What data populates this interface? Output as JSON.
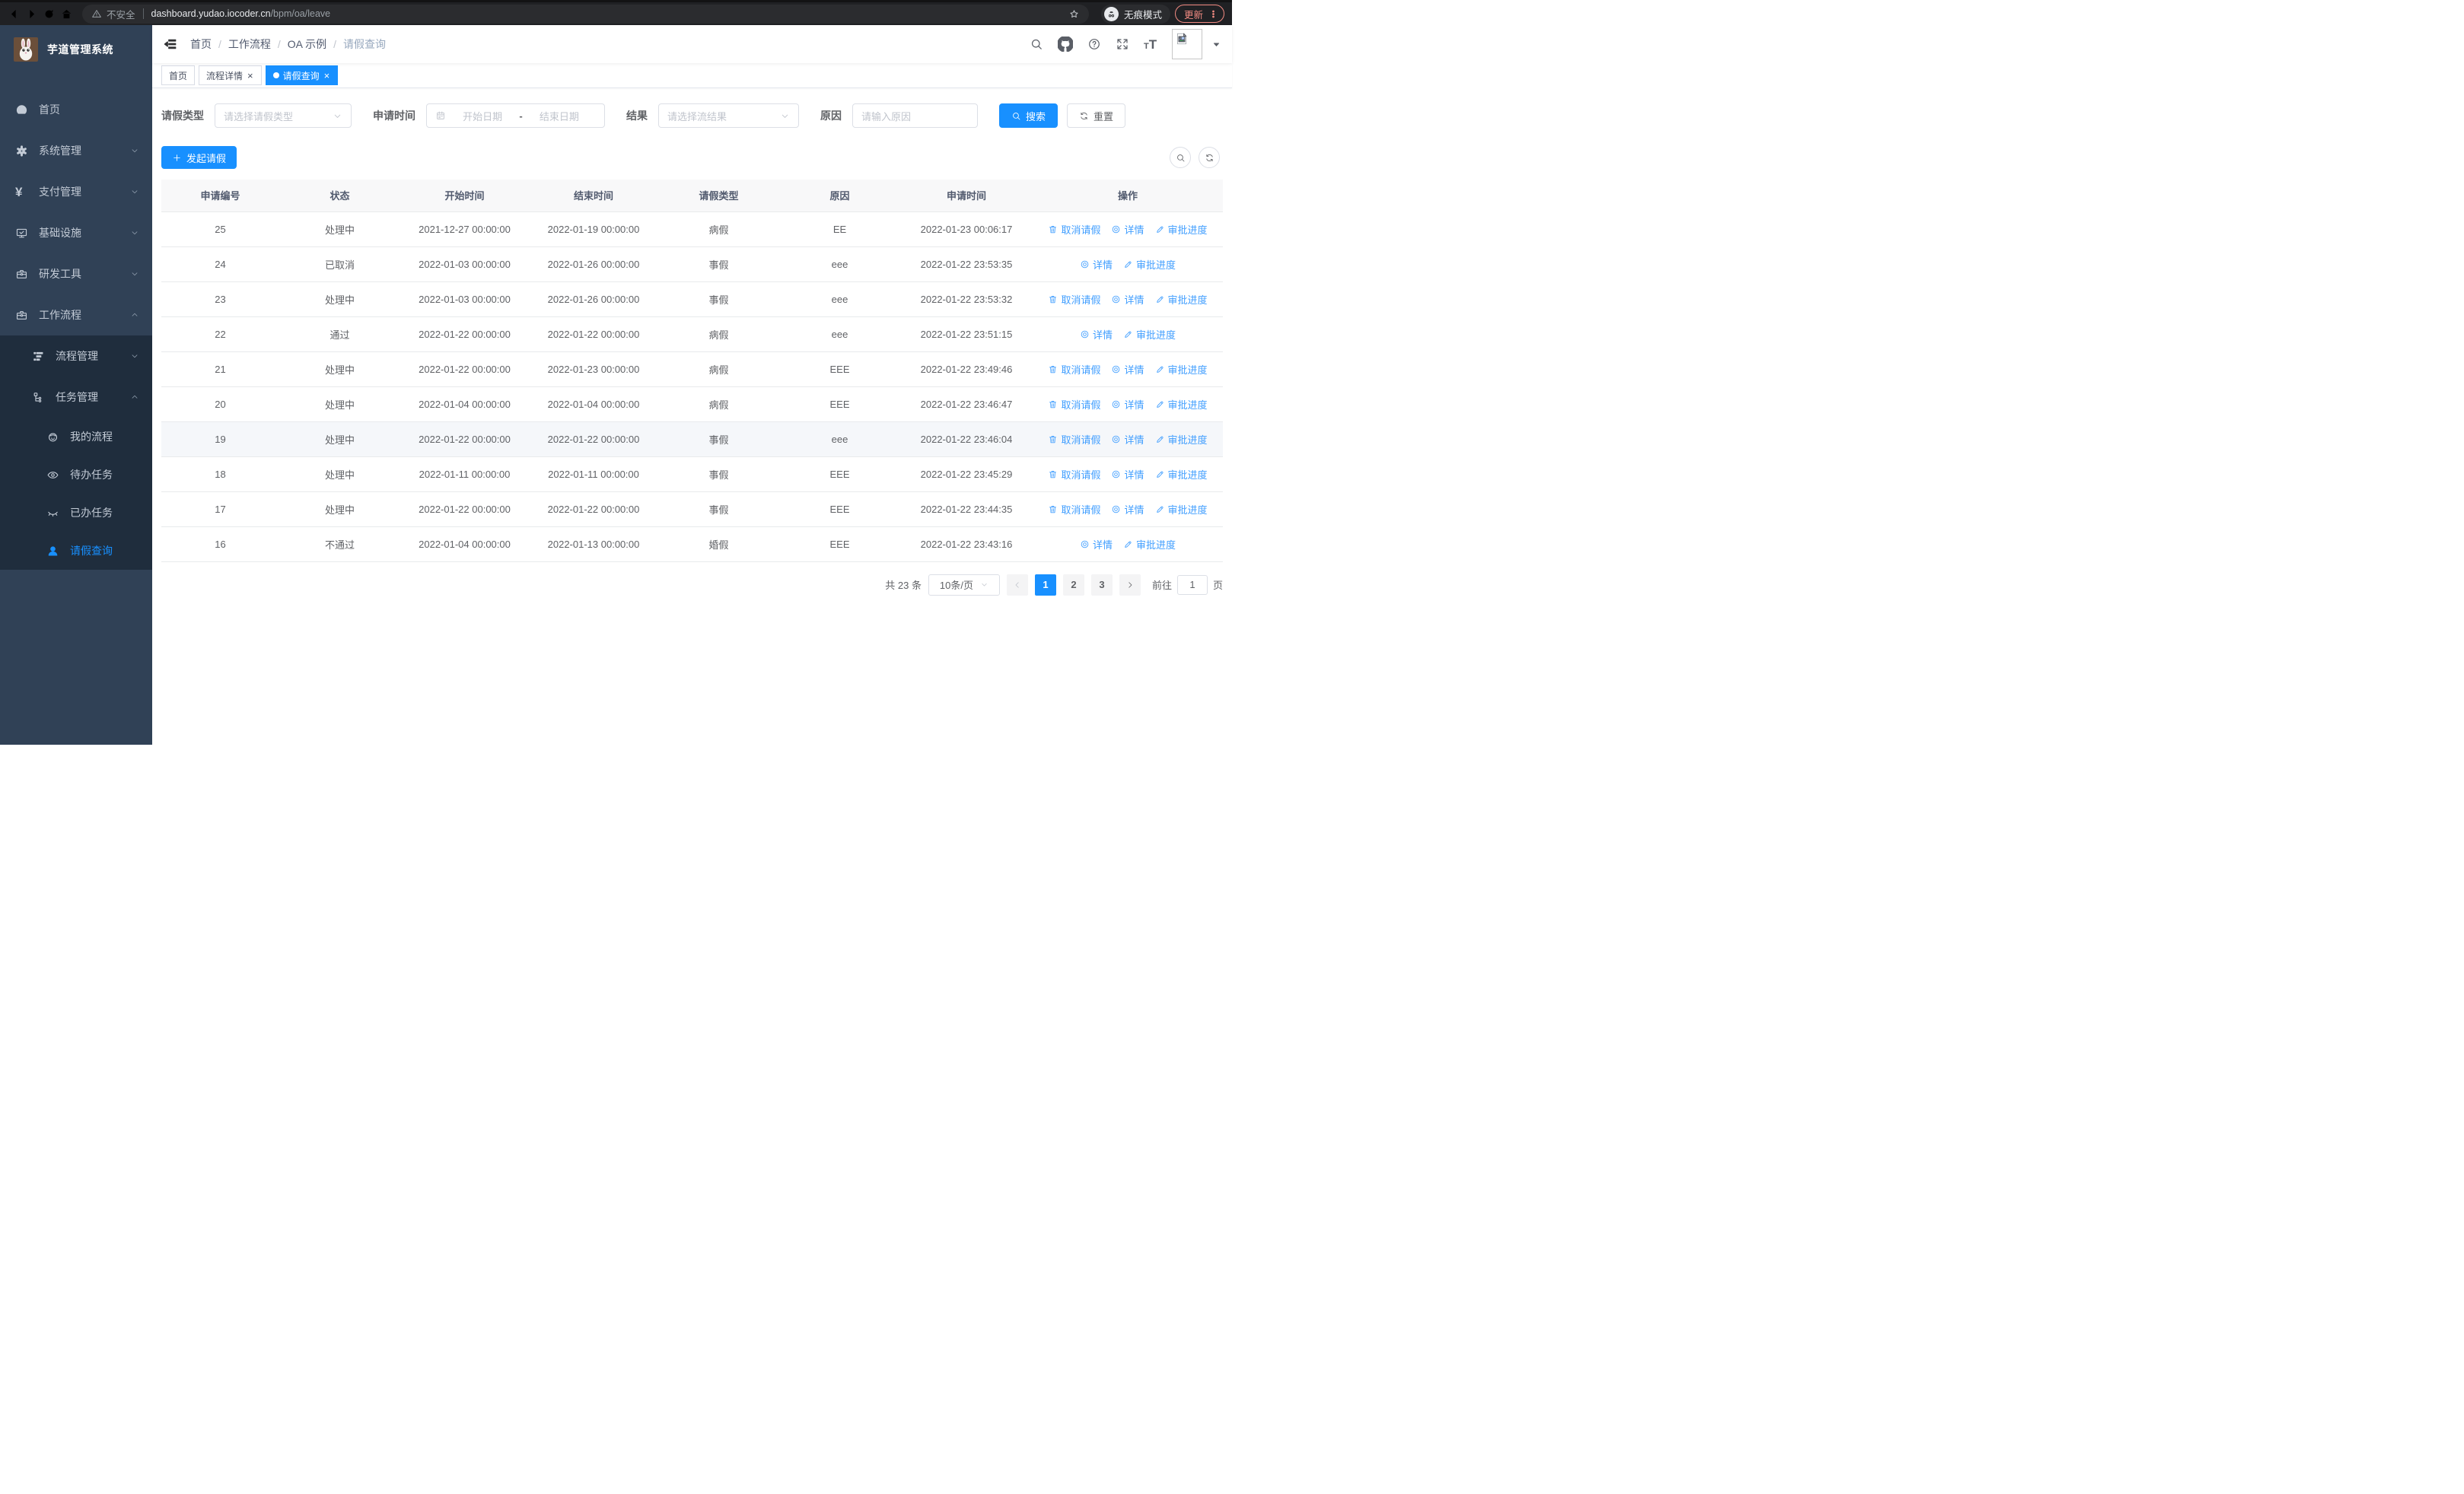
{
  "colors": {
    "primary": "#1890ff",
    "link": "#409eff",
    "sidebar_bg": "#304156",
    "submenu_bg": "#1f2d3d",
    "update_accent": "#f28b82"
  },
  "browser": {
    "security_label": "不安全",
    "url_host": "dashboard.yudao.iocoder.cn",
    "url_path": "/bpm/oa/leave",
    "incognito_label": "无痕模式",
    "update_label": "更新"
  },
  "sidebar": {
    "title": "芋道管理系统",
    "items": [
      {
        "name": "home",
        "icon": "dashboard-icon",
        "label": "首页",
        "level": 1
      },
      {
        "name": "system-management",
        "icon": "gear-icon",
        "label": "系统管理",
        "level": 1,
        "chevron": "down"
      },
      {
        "name": "payment-management",
        "icon": "yen-icon",
        "label": "支付管理",
        "level": 1,
        "chevron": "down"
      },
      {
        "name": "infrastructure",
        "icon": "monitor-icon",
        "label": "基础设施",
        "level": 1,
        "chevron": "down"
      },
      {
        "name": "dev-tools",
        "icon": "toolbox-icon",
        "label": "研发工具",
        "level": 1,
        "chevron": "down"
      },
      {
        "name": "workflow",
        "icon": "toolbox-icon",
        "label": "工作流程",
        "level": 1,
        "chevron": "up"
      },
      {
        "name": "process-management",
        "icon": "list-tree-icon",
        "label": "流程管理",
        "level": 2,
        "chevron": "down",
        "sub": true
      },
      {
        "name": "task-management",
        "icon": "org-tree-icon",
        "label": "任务管理",
        "level": 2,
        "chevron": "up",
        "sub": true
      },
      {
        "name": "my-processes",
        "icon": "robot-icon",
        "label": "我的流程",
        "level": 3,
        "sub": true
      },
      {
        "name": "todo-tasks",
        "icon": "eye-open-icon",
        "label": "待办任务",
        "level": 3,
        "sub": true
      },
      {
        "name": "done-tasks",
        "icon": "eye-closed-icon",
        "label": "已办任务",
        "level": 3,
        "sub": true
      },
      {
        "name": "leave-query",
        "icon": "user-icon",
        "label": "请假查询",
        "level": 3,
        "sub": true,
        "active": true
      }
    ]
  },
  "header": {
    "breadcrumb": [
      "首页",
      "工作流程",
      "OA 示例",
      "请假查询"
    ],
    "icons": [
      {
        "name": "search-icon"
      },
      {
        "name": "github-icon"
      },
      {
        "name": "help-icon"
      },
      {
        "name": "fullscreen-icon"
      },
      {
        "name": "font-size-icon"
      }
    ]
  },
  "tabs": [
    {
      "name": "home",
      "label": "首页"
    },
    {
      "name": "process-detail",
      "label": "流程详情",
      "closable": true
    },
    {
      "name": "leave-query",
      "label": "请假查询",
      "closable": true,
      "active": true
    }
  ],
  "filters": {
    "fields": [
      {
        "name": "leave-type",
        "label": "请假类型",
        "type": "select",
        "placeholder": "请选择请假类型"
      },
      {
        "name": "apply-time",
        "label": "申请时间",
        "type": "daterange",
        "start_placeholder": "开始日期",
        "separator": "-",
        "end_placeholder": "结束日期"
      },
      {
        "name": "result",
        "label": "结果",
        "type": "select",
        "placeholder": "请选择流结果"
      },
      {
        "name": "reason",
        "label": "原因",
        "type": "text",
        "placeholder": "请输入原因"
      }
    ],
    "search_label": "搜索",
    "reset_label": "重置"
  },
  "toolbar": {
    "create_label": "发起请假"
  },
  "table": {
    "columns": [
      "申请编号",
      "状态",
      "开始时间",
      "结束时间",
      "请假类型",
      "原因",
      "申请时间",
      "操作"
    ],
    "action_defs": [
      {
        "key": "cancel",
        "label": "取消请假",
        "icon": "trash-icon"
      },
      {
        "key": "detail",
        "label": "详情",
        "icon": "view-icon"
      },
      {
        "key": "progress",
        "label": "审批进度",
        "icon": "pen-icon"
      }
    ],
    "rows": [
      {
        "id": "25",
        "status": "处理中",
        "start": "2021-12-27 00:00:00",
        "end": "2022-01-19 00:00:00",
        "type": "病假",
        "reason": "EE",
        "applied": "2022-01-23 00:06:17",
        "actions": [
          "cancel",
          "detail",
          "progress"
        ]
      },
      {
        "id": "24",
        "status": "已取消",
        "start": "2022-01-03 00:00:00",
        "end": "2022-01-26 00:00:00",
        "type": "事假",
        "reason": "eee",
        "applied": "2022-01-22 23:53:35",
        "actions": [
          "detail",
          "progress"
        ]
      },
      {
        "id": "23",
        "status": "处理中",
        "start": "2022-01-03 00:00:00",
        "end": "2022-01-26 00:00:00",
        "type": "事假",
        "reason": "eee",
        "applied": "2022-01-22 23:53:32",
        "actions": [
          "cancel",
          "detail",
          "progress"
        ]
      },
      {
        "id": "22",
        "status": "通过",
        "start": "2022-01-22 00:00:00",
        "end": "2022-01-22 00:00:00",
        "type": "病假",
        "reason": "eee",
        "applied": "2022-01-22 23:51:15",
        "actions": [
          "detail",
          "progress"
        ]
      },
      {
        "id": "21",
        "status": "处理中",
        "start": "2022-01-22 00:00:00",
        "end": "2022-01-23 00:00:00",
        "type": "病假",
        "reason": "EEE",
        "applied": "2022-01-22 23:49:46",
        "actions": [
          "cancel",
          "detail",
          "progress"
        ]
      },
      {
        "id": "20",
        "status": "处理中",
        "start": "2022-01-04 00:00:00",
        "end": "2022-01-04 00:00:00",
        "type": "病假",
        "reason": "EEE",
        "applied": "2022-01-22 23:46:47",
        "actions": [
          "cancel",
          "detail",
          "progress"
        ]
      },
      {
        "id": "19",
        "status": "处理中",
        "start": "2022-01-22 00:00:00",
        "end": "2022-01-22 00:00:00",
        "type": "事假",
        "reason": "eee",
        "applied": "2022-01-22 23:46:04",
        "actions": [
          "cancel",
          "detail",
          "progress"
        ],
        "hovered": true
      },
      {
        "id": "18",
        "status": "处理中",
        "start": "2022-01-11 00:00:00",
        "end": "2022-01-11 00:00:00",
        "type": "事假",
        "reason": "EEE",
        "applied": "2022-01-22 23:45:29",
        "actions": [
          "cancel",
          "detail",
          "progress"
        ]
      },
      {
        "id": "17",
        "status": "处理中",
        "start": "2022-01-22 00:00:00",
        "end": "2022-01-22 00:00:00",
        "type": "事假",
        "reason": "EEE",
        "applied": "2022-01-22 23:44:35",
        "actions": [
          "cancel",
          "detail",
          "progress"
        ]
      },
      {
        "id": "16",
        "status": "不通过",
        "start": "2022-01-04 00:00:00",
        "end": "2022-01-13 00:00:00",
        "type": "婚假",
        "reason": "EEE",
        "applied": "2022-01-22 23:43:16",
        "actions": [
          "detail",
          "progress"
        ]
      }
    ]
  },
  "pagination": {
    "total_label": "共 23 条",
    "page_size_label": "10条/页",
    "pages": [
      "1",
      "2",
      "3"
    ],
    "active_page": "1",
    "goto_label": "前往",
    "goto_value": "1",
    "unit_label": "页"
  }
}
